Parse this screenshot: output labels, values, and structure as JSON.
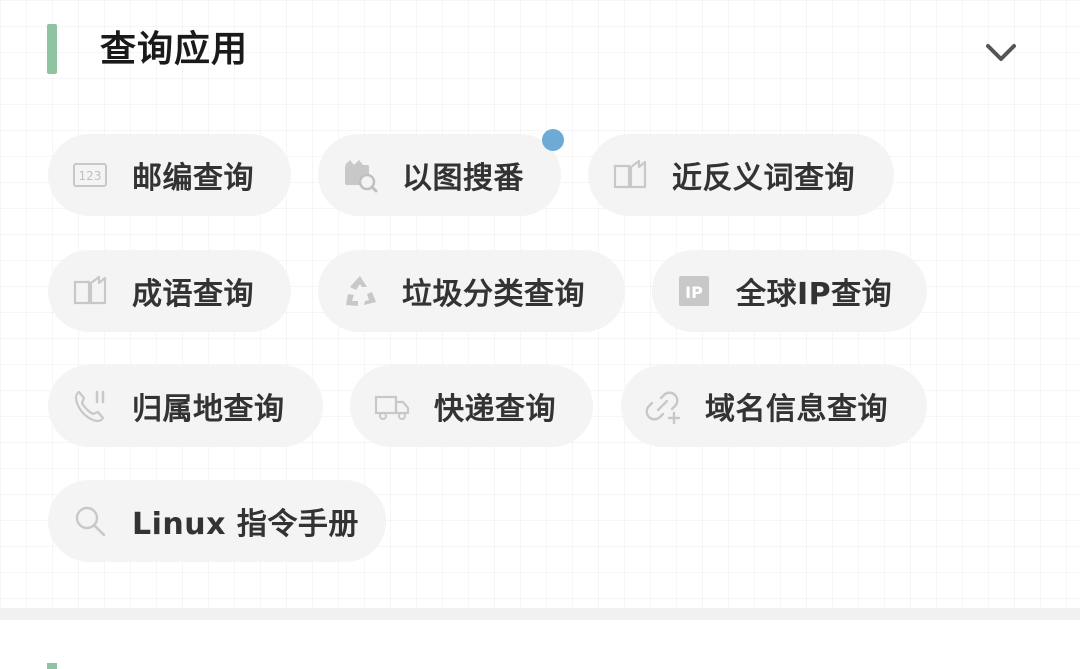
{
  "section": {
    "title": "查询应用",
    "accent_color": "#8fc4a2",
    "collapse_icon": "chevron-down-icon"
  },
  "items": [
    {
      "id": "postcode",
      "label": "邮编查询",
      "icon": "postcode-123-icon"
    },
    {
      "id": "image-search",
      "label": "以图搜番",
      "icon": "film-search-icon",
      "badge": "new-dot",
      "badge_color": "#6eaad6"
    },
    {
      "id": "synonym",
      "label": "近反义词查询",
      "icon": "open-book-icon"
    },
    {
      "id": "idiom",
      "label": "成语查询",
      "icon": "open-book-icon"
    },
    {
      "id": "garbage",
      "label": "垃圾分类查询",
      "icon": "recycle-icon"
    },
    {
      "id": "ip",
      "label": "全球IP查询",
      "icon": "ip-icon"
    },
    {
      "id": "phone-location",
      "label": "归属地查询",
      "icon": "phone-icon"
    },
    {
      "id": "express",
      "label": "快递查询",
      "icon": "truck-icon"
    },
    {
      "id": "domain",
      "label": "域名信息查询",
      "icon": "link-add-icon"
    },
    {
      "id": "linux",
      "label": "Linux 指令手册",
      "icon": "search-icon"
    }
  ]
}
